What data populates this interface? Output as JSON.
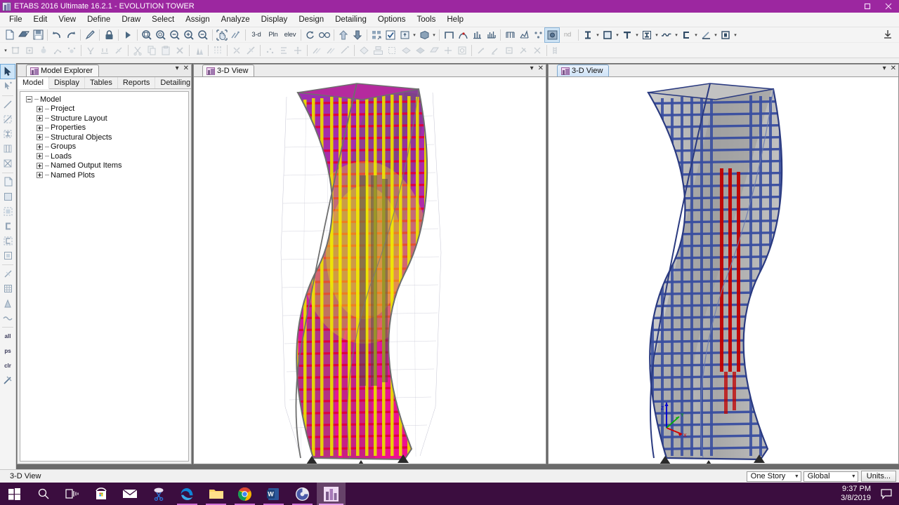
{
  "window": {
    "title": "ETABS 2016 Ultimate 16.2.1 - EVOLUTION TOWER",
    "app_icon": "etabs-icon",
    "restore_label": "Restore",
    "close_label": "Close",
    "titlebar_color": "#9c27a0"
  },
  "menu": {
    "items": [
      {
        "label": "File"
      },
      {
        "label": "Edit"
      },
      {
        "label": "View"
      },
      {
        "label": "Define"
      },
      {
        "label": "Draw"
      },
      {
        "label": "Select"
      },
      {
        "label": "Assign"
      },
      {
        "label": "Analyze"
      },
      {
        "label": "Display"
      },
      {
        "label": "Design"
      },
      {
        "label": "Detailing"
      },
      {
        "label": "Options"
      },
      {
        "label": "Tools"
      },
      {
        "label": "Help"
      }
    ]
  },
  "toolbar_row1": {
    "view_labels": {
      "three_d": "3-d",
      "plan": "Pln",
      "elev": "elev",
      "nd": "nd"
    },
    "buttons": [
      {
        "name": "new-model-button"
      },
      {
        "name": "open-model-button"
      },
      {
        "name": "save-button"
      },
      {
        "name": "undo-button"
      },
      {
        "name": "redo-button"
      },
      {
        "name": "edit-button"
      },
      {
        "name": "lock-model-button"
      },
      {
        "name": "run-analysis-button"
      },
      {
        "name": "zoom-window-button"
      },
      {
        "name": "zoom-in-button"
      },
      {
        "name": "zoom-out-button"
      },
      {
        "name": "zoom-in-one-step-button"
      },
      {
        "name": "zoom-out-one-step-button"
      },
      {
        "name": "pan-button"
      },
      {
        "name": "rubber-band-zoom-button"
      },
      {
        "name": "3d-view-button"
      },
      {
        "name": "plan-view-button"
      },
      {
        "name": "elevation-view-button"
      },
      {
        "name": "rotate-3d-view-button"
      },
      {
        "name": "perspective-toggle-button"
      },
      {
        "name": "move-up-story-button"
      },
      {
        "name": "move-down-story-button"
      },
      {
        "name": "set-display-options-button"
      },
      {
        "name": "object-assigns-button"
      },
      {
        "name": "extrude-view-button"
      },
      {
        "name": "render-view-button"
      },
      {
        "name": "show-undeformed-shape-button"
      },
      {
        "name": "show-deformed-shape-button"
      },
      {
        "name": "show-forces-diagram-button"
      },
      {
        "name": "show-stress-diagram-button"
      },
      {
        "name": "show-table-button"
      },
      {
        "name": "show-design-results-button"
      },
      {
        "name": "display-mode-button"
      },
      {
        "name": "capture-picture-button"
      }
    ],
    "section_dropdowns": [
      {
        "name": "frame-section-dropdown"
      },
      {
        "name": "area-section-dropdown"
      },
      {
        "name": "tee-section-dropdown"
      },
      {
        "name": "wide-flange-dropdown"
      },
      {
        "name": "deck-section-dropdown"
      },
      {
        "name": "channel-section-dropdown"
      },
      {
        "name": "angle-section-dropdown"
      },
      {
        "name": "box-section-dropdown"
      }
    ],
    "download_button": "download-icon"
  },
  "toolbar_row2": {
    "buttons": [
      {
        "name": "snap-options-button"
      },
      {
        "name": "snap-to-point-button"
      },
      {
        "name": "snap-to-grid-button"
      },
      {
        "name": "snap-to-midpoint-button"
      },
      {
        "name": "snap-to-line-button"
      },
      {
        "name": "snap-to-intersection-button"
      },
      {
        "name": "snap-to-perpendicular-button"
      },
      {
        "name": "snap-to-nearest-button"
      },
      {
        "name": "snap-to-fine-grid-button"
      },
      {
        "name": "cut-button"
      },
      {
        "name": "copy-button"
      },
      {
        "name": "paste-button"
      },
      {
        "name": "delete-button"
      },
      {
        "name": "set-building-view-button"
      },
      {
        "name": "show-grid-button"
      },
      {
        "name": "mesh-area-button"
      },
      {
        "name": "divide-frame-button"
      },
      {
        "name": "join-frames-button"
      },
      {
        "name": "align-points-button"
      },
      {
        "name": "move-points-button"
      },
      {
        "name": "edit-lines-button"
      },
      {
        "name": "trim-lines-button"
      },
      {
        "name": "extend-lines-button"
      },
      {
        "name": "divide-lines-button"
      },
      {
        "name": "merge-areas-button"
      },
      {
        "name": "expand-areas-button"
      },
      {
        "name": "chamfer-areas-button"
      },
      {
        "name": "offset-areas-button"
      },
      {
        "name": "area-openings-button"
      },
      {
        "name": "point-loads-button"
      },
      {
        "name": "frame-loads-button"
      },
      {
        "name": "area-loads-button"
      },
      {
        "name": "assign-restraints-button"
      },
      {
        "name": "assign-releases-button"
      },
      {
        "name": "story-data-button"
      }
    ]
  },
  "left_toolbar": {
    "buttons": [
      {
        "name": "pointer-select-tool",
        "active": true
      },
      {
        "name": "select-object-tool",
        "active": false
      },
      {
        "name": "draw-line-tool",
        "active": false
      },
      {
        "name": "quick-draw-brace-tool",
        "active": false
      },
      {
        "name": "quick-draw-beam-tool",
        "active": false
      },
      {
        "name": "quick-draw-column-tool",
        "active": false
      },
      {
        "name": "quick-draw-secondary-beam-tool",
        "active": false
      },
      {
        "name": "draw-floor-area-tool",
        "active": false
      },
      {
        "name": "draw-rect-area-tool",
        "active": false
      },
      {
        "name": "quick-draw-area-tool",
        "active": false
      },
      {
        "name": "draw-wall-tool",
        "active": false
      },
      {
        "name": "quick-draw-wall-tool",
        "active": false
      },
      {
        "name": "draw-opening-tool",
        "active": false
      },
      {
        "name": "draw-reference-line-tool",
        "active": false
      },
      {
        "name": "draw-developed-elevation-tool",
        "active": false
      },
      {
        "name": "draw-dimension-line-tool",
        "active": false
      },
      {
        "name": "draw-section-cut-tool",
        "active": false
      }
    ],
    "select_labels": {
      "all": "all",
      "previous": "ps",
      "clear": "clr"
    }
  },
  "model_explorer": {
    "tab_title": "Model Explorer",
    "tab_icon": "etabs-mini-icon",
    "collapse_label": "▾",
    "close_label": "✕",
    "tabs": [
      {
        "label": "Model",
        "selected": true
      },
      {
        "label": "Display",
        "selected": false
      },
      {
        "label": "Tables",
        "selected": false
      },
      {
        "label": "Reports",
        "selected": false
      },
      {
        "label": "Detailing",
        "selected": false
      }
    ],
    "tree": [
      {
        "label": "Model",
        "level": 0,
        "expanded": true
      },
      {
        "label": "Project",
        "level": 1,
        "expanded": false
      },
      {
        "label": "Structure Layout",
        "level": 1,
        "expanded": false
      },
      {
        "label": "Properties",
        "level": 1,
        "expanded": false
      },
      {
        "label": "Structural Objects",
        "level": 1,
        "expanded": false
      },
      {
        "label": "Groups",
        "level": 1,
        "expanded": false
      },
      {
        "label": "Loads",
        "level": 1,
        "expanded": false
      },
      {
        "label": "Named Output Items",
        "level": 1,
        "expanded": false
      },
      {
        "label": "Named Plots",
        "level": 1,
        "expanded": false
      }
    ]
  },
  "views": {
    "left": {
      "tab_label": "3-D View",
      "tab_icon": "etabs-mini-icon",
      "active": false,
      "collapse_label": "▾",
      "close_label": "✕",
      "model_name": "EVOLUTION TOWER",
      "render_mode": "extruded-shell-colored",
      "colors": {
        "shell": "#c8209a",
        "shell_upper": "#a030a8",
        "beam": "#e00040",
        "column": "#e8e000",
        "grid": "#b8b8c8",
        "outline": "#707070"
      }
    },
    "right": {
      "tab_label": "3-D View",
      "tab_icon": "etabs-mini-icon",
      "active": true,
      "collapse_label": "▾",
      "close_label": "✕",
      "model_name": "EVOLUTION TOWER",
      "render_mode": "extruded-frame",
      "colors": {
        "frame": "#3a4fa0",
        "slab": "#b4b4b4",
        "core": "#c00000",
        "outline": "#2a3a80"
      },
      "axes": {
        "x": "X",
        "y": "Y",
        "z": "Z",
        "x_color": "#d00000",
        "y_color": "#00b000",
        "z_color": "#0000d0"
      }
    }
  },
  "statusbar": {
    "message": "3-D View",
    "story_select": "One Story",
    "coord_select": "Global",
    "units_button": "Units..."
  },
  "taskbar": {
    "items": [
      {
        "name": "start-button",
        "label": "Start"
      },
      {
        "name": "search-button",
        "label": "Search"
      },
      {
        "name": "task-view-button",
        "label": "Task View"
      },
      {
        "name": "microsoft-store-button",
        "label": "Microsoft Store"
      },
      {
        "name": "mail-button",
        "label": "Mail"
      },
      {
        "name": "snipping-tool-button",
        "label": "Snip & Sketch"
      },
      {
        "name": "edge-button",
        "label": "Microsoft Edge"
      },
      {
        "name": "file-explorer-button",
        "label": "File Explorer"
      },
      {
        "name": "chrome-button",
        "label": "Google Chrome"
      },
      {
        "name": "word-button",
        "label": "Microsoft Word"
      },
      {
        "name": "bittorrent-button",
        "label": "BitTorrent"
      },
      {
        "name": "etabs-taskbar-button",
        "label": "ETABS 2016"
      }
    ],
    "clock_time": "9:37 PM",
    "clock_date": "3/8/2019",
    "notification_label": "Notifications"
  }
}
